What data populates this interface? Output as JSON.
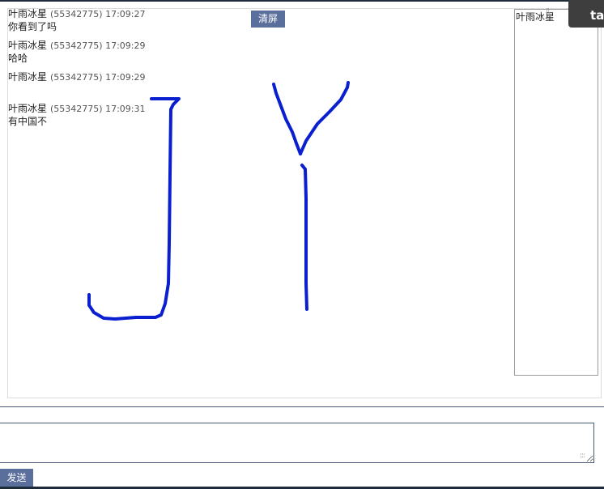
{
  "messages": [
    {
      "name": "叶雨冰星",
      "id": "(55342775)",
      "time": "17:09:27",
      "text": "你看到了吗"
    },
    {
      "name": "叶雨冰星",
      "id": "(55342775)",
      "time": "17:09:29",
      "text": "哈哈"
    },
    {
      "name": "叶雨冰星",
      "id": "(55342775)",
      "time": "17:09:29",
      "text": ""
    },
    {
      "name": "叶雨冰星",
      "id": "(55342775)",
      "time": "17:09:31",
      "text": "有中国不"
    }
  ],
  "toolbar": {
    "clear_label": "清屏"
  },
  "users": [
    "叶雨冰星"
  ],
  "overlay": {
    "label": "tar"
  },
  "composer": {
    "value": "",
    "send_label": "发送"
  },
  "colors": {
    "ink": "#0a1fd0",
    "button": "#5b6f9d",
    "border": "#4a5b7a"
  },
  "drawing": {
    "strokes": "freehand J and Y in blue ink"
  }
}
